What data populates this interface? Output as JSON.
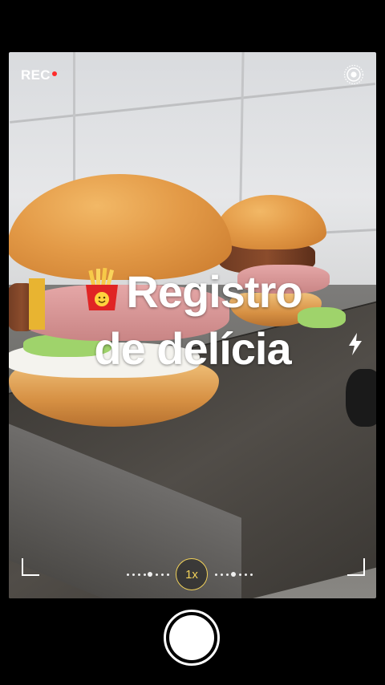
{
  "status": {
    "rec_label": "REC"
  },
  "overlay": {
    "line1": "Registro",
    "line2": "de delícia",
    "emoji": "fries-emoji"
  },
  "controls": {
    "zoom_label": "1x",
    "live_icon": "live-photo-icon",
    "flash_icon": "flash-icon",
    "shutter": "shutter-button"
  },
  "colors": {
    "accent_zoom": "#f2d25a",
    "rec_dot": "#ff2b2b",
    "text": "#ffffff"
  }
}
